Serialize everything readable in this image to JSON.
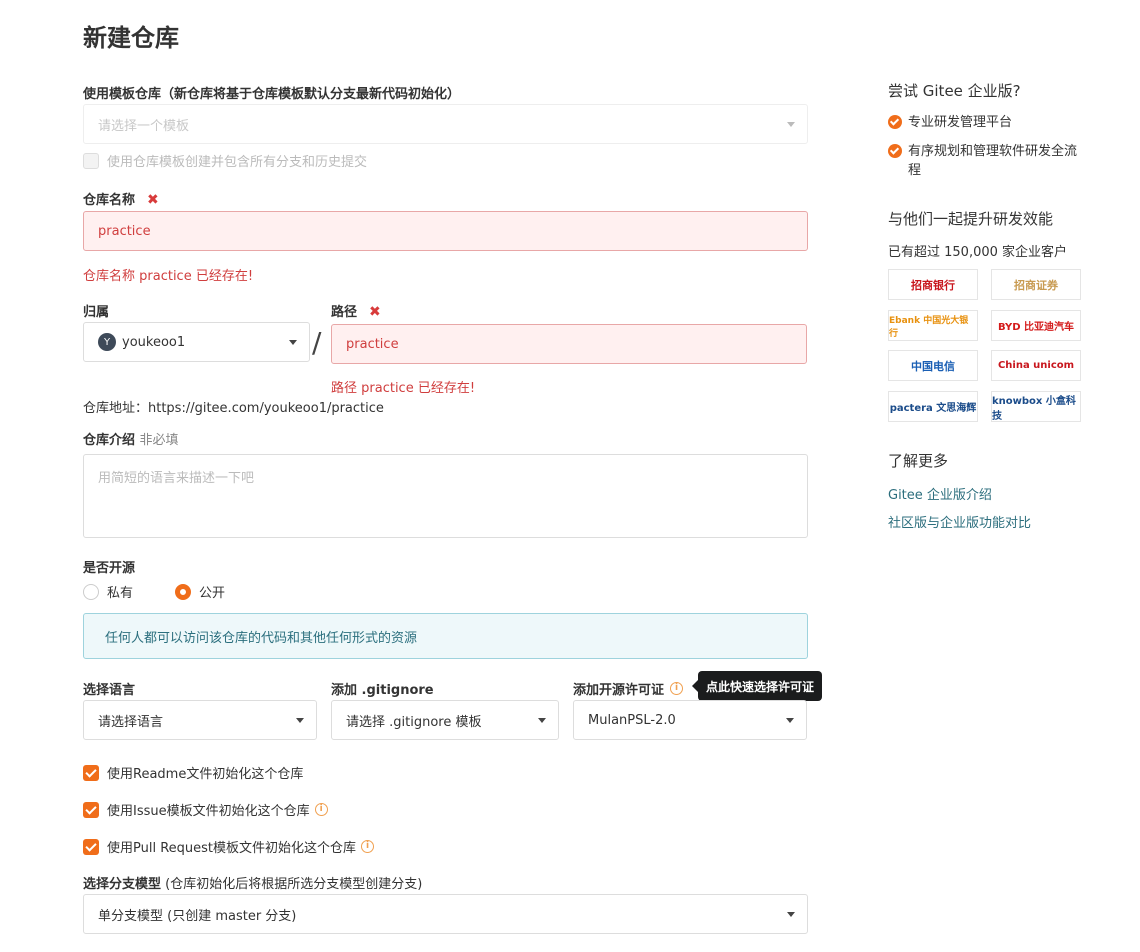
{
  "page_title": "新建仓库",
  "template": {
    "label": "使用模板仓库（新仓库将基于仓库模板默认分支最新代码初始化）",
    "placeholder": "请选择一个模板",
    "checkbox_label": "使用仓库模板创建并包含所有分支和历史提交"
  },
  "repo_name": {
    "label": "仓库名称",
    "value": "practice",
    "error": "仓库名称 practice 已经存在!"
  },
  "owner": {
    "label": "归属",
    "avatar_letter": "Y",
    "value": "youkeoo1"
  },
  "path": {
    "label": "路径",
    "value": "practice",
    "error": "路径 practice 已经存在!"
  },
  "separator": "/",
  "repo_address": "仓库地址：https://gitee.com/youkeoo1/practice",
  "description": {
    "label": "仓库介绍",
    "optional": "非必填",
    "placeholder": "用简短的语言来描述一下吧"
  },
  "visibility": {
    "label": "是否开源",
    "private_label": "私有",
    "public_label": "公开",
    "selected": "public",
    "notice": "任何人都可以访问该仓库的代码和其他任何形式的资源"
  },
  "language": {
    "label": "选择语言",
    "value": "请选择语言"
  },
  "gitignore": {
    "label": "添加 .gitignore",
    "value": "请选择 .gitignore 模板"
  },
  "license": {
    "label": "添加开源许可证",
    "value": "MulanPSL-2.0",
    "tooltip": "点此快速选择许可证"
  },
  "init_options": [
    {
      "label": "使用Readme文件初始化这个仓库",
      "checked": true,
      "info": false
    },
    {
      "label": "使用Issue模板文件初始化这个仓库",
      "checked": true,
      "info": true
    },
    {
      "label": "使用Pull Request模板文件初始化这个仓库",
      "checked": true,
      "info": true
    }
  ],
  "branch_model": {
    "label": "选择分支模型",
    "hint": "(仓库初始化后将根据所选分支模型创建分支)",
    "value": "单分支模型 (只创建 master 分支)"
  },
  "sidebar": {
    "try_title": "尝试 Gitee 企业版?",
    "features": [
      "专业研发管理平台",
      "有序规划和管理软件研发全流程"
    ],
    "join_title": "与他们一起提升研发效能",
    "customers": "已有超过 150,000 家企业客户",
    "logos": [
      "招商银行",
      "招商证券",
      "Ebank 中国光大银行",
      "BYD 比亚迪汽车",
      "中国电信",
      "China unicom",
      "pactera 文思海辉",
      "knowbox 小盒科技"
    ],
    "learn_title": "了解更多",
    "links": [
      "Gitee 企业版介绍",
      "社区版与企业版功能对比"
    ]
  },
  "colors": {
    "accent": "#f06d1a",
    "error": "#d03e3e",
    "link": "#2c6e7d"
  }
}
